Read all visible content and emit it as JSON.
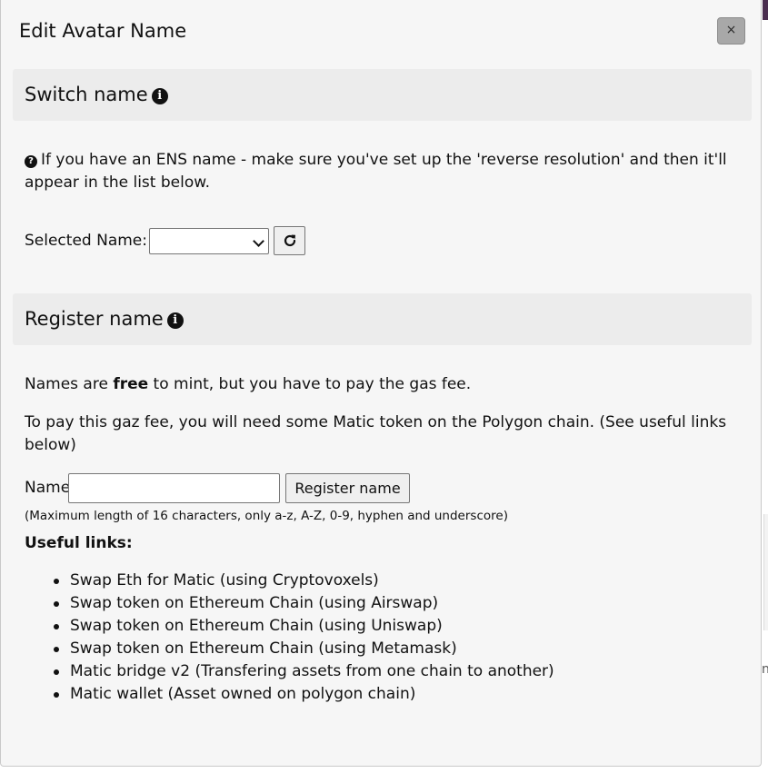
{
  "dialog": {
    "title": "Edit Avatar Name",
    "close_label": "×"
  },
  "switch_section": {
    "title": "Switch name",
    "info_icon": "info-circle-icon",
    "hint_icon": "question-circle-icon",
    "hint_text": "If you have an ENS name - make sure you've set up the 'reverse resolution' and then it'll appear in the list below.",
    "selected_label": "Selected Name:",
    "selected_value": "",
    "refresh_icon": "refresh-icon"
  },
  "register_section": {
    "title": "Register name",
    "info_icon": "info-circle-icon",
    "free_pre": "Names are ",
    "free_bold": "free",
    "free_post": " to mint, but you have to pay the gas fee.",
    "gas_text": "To pay this gaz fee, you will need some Matic token on the Polygon chain. (See useful links below)",
    "name_label": "Name",
    "name_value": "",
    "register_label": "Register name",
    "hint": "(Maximum length of 16 characters, only a-z, A-Z, 0-9, hyphen and underscore)"
  },
  "useful_links": {
    "title": "Useful links:",
    "items": [
      "Swap Eth for Matic (using Cryptovoxels)",
      "Swap token on Ethereum Chain (using Airswap)",
      "Swap token on Ethereum Chain (using Uniswap)",
      "Swap token on Ethereum Chain (using Metamask)",
      "Matic bridge v2 (Transfering assets from one chain to another)",
      "Matic wallet (Asset owned on polygon chain)"
    ]
  },
  "background": {
    "edge_char": "n"
  },
  "colors": {
    "dialog_bg": "#f6f6f6",
    "section_header_bg": "#ececec",
    "close_button_bg": "#a8a8a8",
    "edge_accent": "#4a2e4f"
  }
}
